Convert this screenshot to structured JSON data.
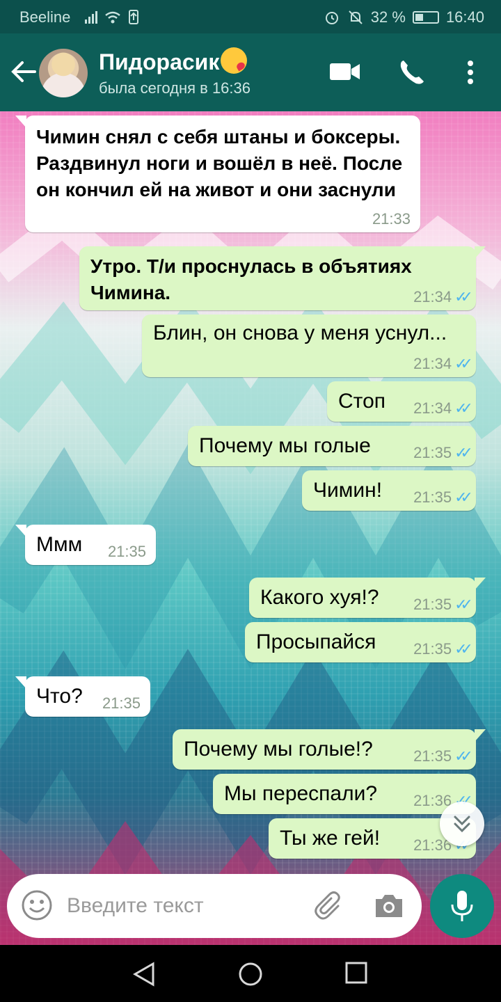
{
  "status_bar": {
    "carrier": "Beeline",
    "battery": "32 %",
    "battery_level": 0.32,
    "time": "16:40"
  },
  "header": {
    "contact_name": "Пидорасик",
    "last_seen": "была сегодня в 16:36"
  },
  "messages": [
    {
      "dir": "in",
      "text": "Чимин снял с себя штаны и боксеры. Раздвинул ноги и вошёл в неё. После он кончил ей на живот и они заснули",
      "time": "21:33"
    },
    {
      "dir": "out",
      "text": "Утро. Т/и проснулась в объятиях Чимина.",
      "time": "21:34"
    },
    {
      "dir": "out",
      "text": "Блин, он снова у меня уснул...",
      "time": "21:34"
    },
    {
      "dir": "out",
      "text": "Стоп",
      "time": "21:34"
    },
    {
      "dir": "out",
      "text": "Почему мы голые",
      "time": "21:35"
    },
    {
      "dir": "out",
      "text": "Чимин!",
      "time": "21:35"
    },
    {
      "dir": "in",
      "text": "Ммм",
      "time": "21:35"
    },
    {
      "dir": "out",
      "text": "Какого хуя!?",
      "time": "21:35"
    },
    {
      "dir": "out",
      "text": "Просыпайся",
      "time": "21:35"
    },
    {
      "dir": "in",
      "text": "Что?",
      "time": "21:35"
    },
    {
      "dir": "out",
      "text": "Почему мы голые!?",
      "time": "21:35"
    },
    {
      "dir": "out",
      "text": "Мы переспали?",
      "time": "21:36"
    },
    {
      "dir": "out",
      "text": "Ты же гей!",
      "time": "21:36"
    }
  ],
  "read_receipt": "✓✓",
  "input": {
    "placeholder": "Введите текст"
  },
  "icons": {
    "back": "arrow-left-icon",
    "video": "video-call-icon",
    "call": "phone-icon",
    "more": "more-vertical-icon",
    "emoji": "emoji-icon",
    "attach": "paperclip-icon",
    "camera": "camera-icon",
    "mic": "mic-icon",
    "scroll": "chevron-double-down-icon"
  },
  "colors": {
    "header": "#0d5e58",
    "status_bar": "#0c504c",
    "outgoing_bubble": "#dcf7c5",
    "incoming_bubble": "#ffffff",
    "tick_blue": "#4fb4ee",
    "mic_button": "#0e8a7f"
  }
}
